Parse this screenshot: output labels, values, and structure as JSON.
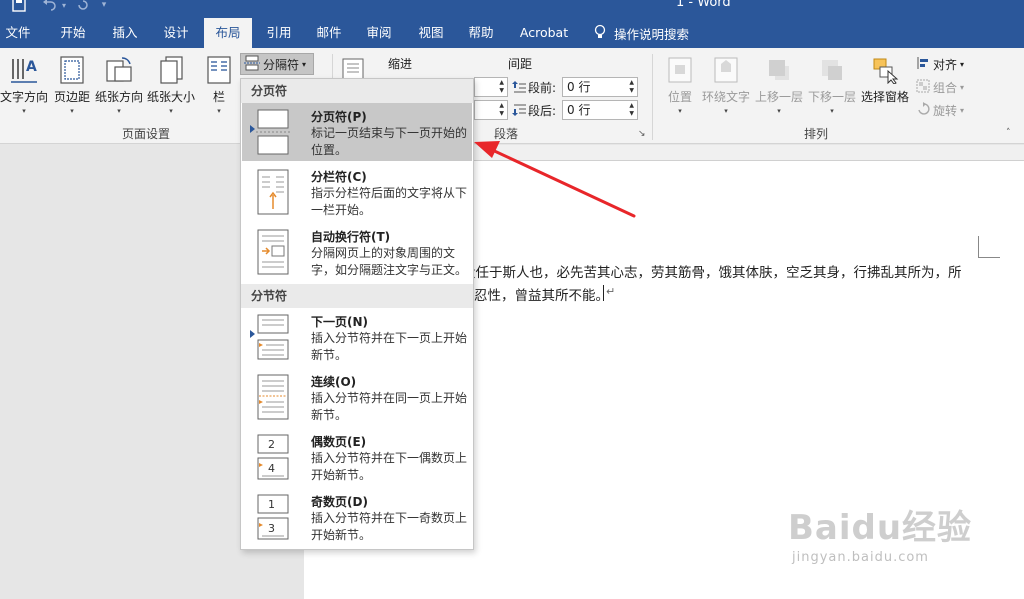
{
  "window": {
    "title": "1 - Word"
  },
  "tabs": [
    "文件",
    "开始",
    "插入",
    "设计",
    "布局",
    "引用",
    "邮件",
    "审阅",
    "视图",
    "帮助",
    "Acrobat"
  ],
  "tell_me": "操作说明搜索",
  "ribbon": {
    "page_setup": {
      "buttons": [
        "文字方向",
        "页边距",
        "纸张方向",
        "纸张大小",
        "栏"
      ],
      "breaks_label": "分隔符",
      "group_label": "页面设置"
    },
    "paragraph": {
      "indent_label": "缩进",
      "spacing_label": "间距",
      "before_label": "段前:",
      "after_label": "段后:",
      "before_value": "0 行",
      "after_value": "0 行",
      "group_label": "段落"
    },
    "arrange": {
      "buttons": [
        "位置",
        "环绕文字",
        "上移一层",
        "下移一层",
        "选择窗格"
      ],
      "align_label": "对齐",
      "group_objects_label": "组合",
      "rotate_label": "旋转",
      "group_label": "排列"
    }
  },
  "dropdown": {
    "page_breaks_header": "分页符",
    "section_breaks_header": "分节符",
    "items": [
      {
        "title": "分页符(P)",
        "desc": "标记一页结束与下一页开始的位置。"
      },
      {
        "title": "分栏符(C)",
        "desc": "指示分栏符后面的文字将从下一栏开始。"
      },
      {
        "title": "自动换行符(T)",
        "desc": "分隔网页上的对象周围的文字，如分隔题注文字与正文。"
      },
      {
        "title": "下一页(N)",
        "desc": "插入分节符并在下一页上开始新节。"
      },
      {
        "title": "连续(O)",
        "desc": "插入分节符并在同一页上开始新节。"
      },
      {
        "title": "偶数页(E)",
        "desc": "插入分节符并在下一偶数页上开始新节。"
      },
      {
        "title": "奇数页(D)",
        "desc": "插入分节符并在下一奇数页上开始新节。"
      }
    ]
  },
  "document": {
    "line1": "大任于斯人也，必先苦其心志，劳其筋骨，饿其体肤，空乏其身，行拂乱其所为，所",
    "line2": "忍性，曾益其所不能。"
  },
  "watermark": {
    "brand": "Baidu经验",
    "url": "jingyan.baidu.com"
  },
  "colors": {
    "brand": "#2b579a",
    "annotation": "#e8262a"
  }
}
